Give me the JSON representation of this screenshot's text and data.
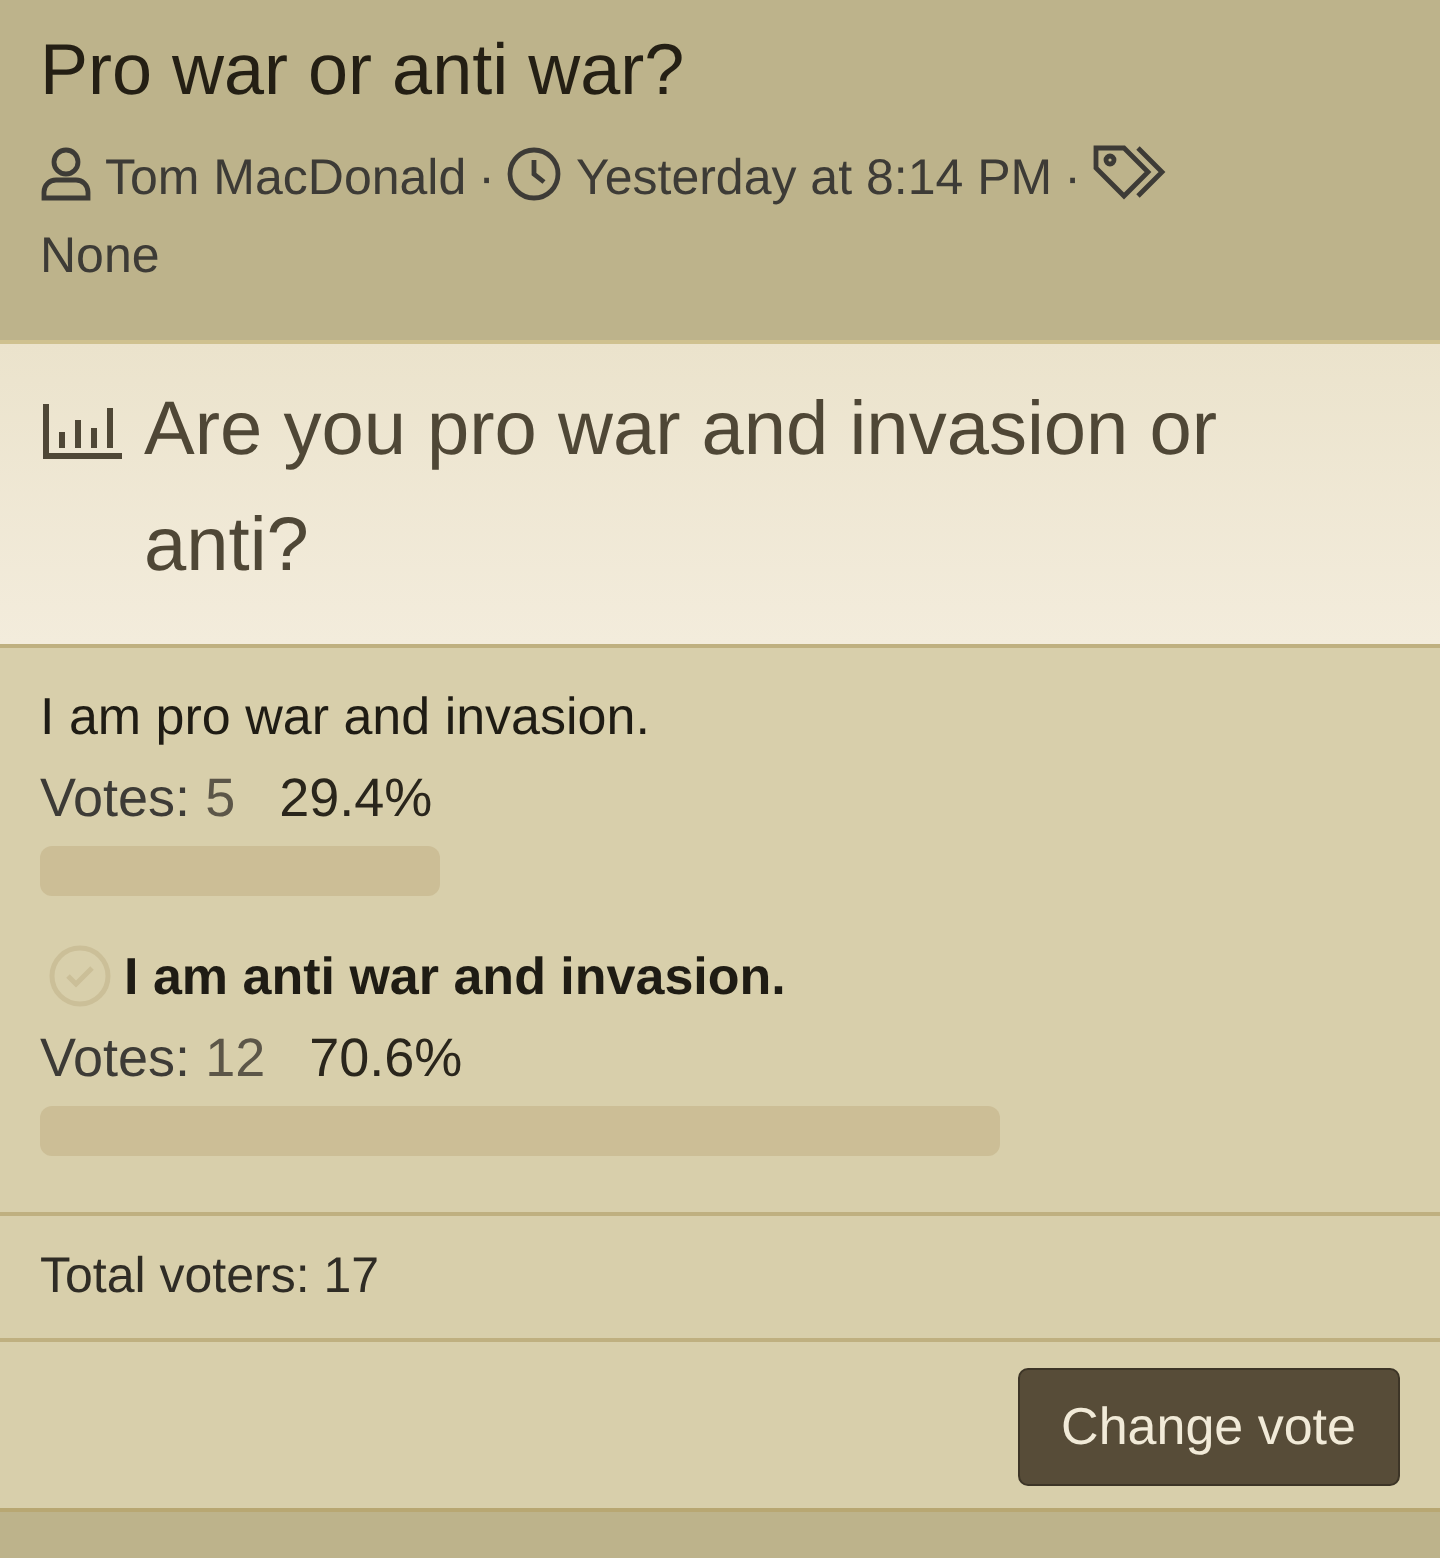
{
  "thread": {
    "title": "Pro war or anti war?",
    "author": "Tom MacDonald",
    "time": "Yesterday at 8:14 PM",
    "tags": "None",
    "separator": "·"
  },
  "poll": {
    "question": "Are you pro war and invasion or anti?",
    "options": [
      {
        "text": "I am pro war and invasion.",
        "voted": false,
        "votes_label": "Votes:",
        "votes": "5",
        "percent": "29.4%"
      },
      {
        "text": "I am anti war and invasion.",
        "voted": true,
        "votes_label": "Votes:",
        "votes": "12",
        "percent": "70.6%"
      }
    ],
    "total": "Total voters: 17",
    "button": "Change vote"
  }
}
